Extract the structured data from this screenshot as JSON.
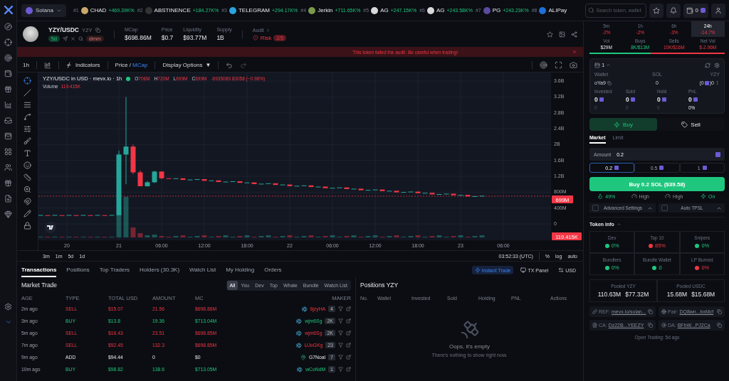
{
  "topbar": {
    "chain": "Solana",
    "trending": [
      {
        "rank": "#1",
        "name": "CHAD",
        "change": "+469.39K%"
      },
      {
        "rank": "#2",
        "name": "ABSTINENCE",
        "change": "+184.27K%"
      },
      {
        "rank": "#3",
        "name": "TELEGRAM",
        "change": "+294.17K%"
      },
      {
        "rank": "#4",
        "name": "Jerkin",
        "change": "+711.65K%"
      },
      {
        "rank": "#5",
        "name": "AG",
        "change": "+247.15K%"
      },
      {
        "rank": "#6",
        "name": "AG",
        "change": "+243.58K%"
      },
      {
        "rank": "#7",
        "name": "PG",
        "change": "+243.23K%"
      },
      {
        "rank": "#8",
        "name": "ALIPay"
      }
    ],
    "search": {
      "placeholder": "Search token, wallet"
    },
    "wallet_count": "0"
  },
  "token": {
    "pair": "YZY/USDC",
    "symbol": "YZY",
    "age": "5d",
    "tag": "dimm",
    "stats": [
      {
        "label": "MCap",
        "value": "$698.86M"
      },
      {
        "label": "Price",
        "value": "$0.7"
      },
      {
        "label": "Liquidity",
        "value": "$93.77M"
      },
      {
        "label": "Supply",
        "value": "1B"
      }
    ],
    "audit": {
      "label": "Audit",
      "risk": "Risk",
      "score": "2/5"
    }
  },
  "banner": "This token failed the audit. Be careful when trading!",
  "chart_toolbar": {
    "interval": "1h",
    "indicators": "Indicators",
    "price_modes": [
      {
        "label": "Price",
        "selected": false
      },
      {
        "label": "MCap",
        "selected": true
      }
    ],
    "separator": "/",
    "display": "Display Options",
    "display_caret": "▼"
  },
  "chart": {
    "title": "YZY/USDC in USD · mevx.io · 1h",
    "ohlc": [
      {
        "key": "O",
        "value": "706M"
      },
      {
        "key": "H",
        "value": "720M"
      },
      {
        "key": "L",
        "value": "699M"
      },
      {
        "key": "C",
        "value": "699M"
      }
    ],
    "change": "-6935089.83058 (−0.98%)",
    "volume_label": "Volume",
    "volume_value": "119.415K",
    "y_labels": [
      "3.6B",
      "3.2B",
      "2.8B",
      "2.4B",
      "2B",
      "1.6B",
      "1.2B",
      "800M",
      "400M",
      "0"
    ],
    "x_labels": [
      "20",
      "21",
      "06:00",
      "12:00",
      "18:00",
      "22",
      "06:00",
      "12:00",
      "18:00",
      "23",
      "06:00"
    ],
    "price_tag": "699M",
    "volume_tag": "119.415K",
    "ranges": [
      "3m",
      "1m",
      "5d",
      "1d"
    ],
    "clock": "03:52:33 (UTC)",
    "scale_options": [
      "%",
      "log",
      "auto"
    ]
  },
  "bottom_tabs": [
    {
      "label": "Transactions",
      "selected": true
    },
    {
      "label": "Positions",
      "selected": false
    },
    {
      "label": "Top Traders",
      "selected": false
    },
    {
      "label": "Holders (30.3K)",
      "selected": false
    },
    {
      "label": "Watch List",
      "selected": false
    },
    {
      "label": "My Holding",
      "selected": false
    },
    {
      "label": "Orders",
      "selected": false
    }
  ],
  "trade_options": [
    {
      "label": "Instant Trade",
      "selected": true
    },
    {
      "label": "TX Panel",
      "selected": false
    },
    {
      "label": "USD",
      "selected": false
    }
  ],
  "market_trade": {
    "title": "Market Trade",
    "filters": [
      {
        "label": "All",
        "selected": true
      },
      {
        "label": "You",
        "selected": false
      },
      {
        "label": "Dev",
        "selected": false
      },
      {
        "label": "Top",
        "selected": false
      },
      {
        "label": "Whale",
        "selected": false
      },
      {
        "label": "Bundle",
        "selected": false
      },
      {
        "label": "Watch List",
        "selected": false
      }
    ],
    "columns": [
      "AGE",
      "TYPE",
      "TOTAL USD",
      "AMOUNT",
      "MC",
      "MAKER"
    ],
    "rows": [
      {
        "age": "2m ago",
        "type": "SELL",
        "kind": "sell",
        "total": "$15.07",
        "amount": "21.56",
        "mc": "$698.86M",
        "maker": "6jzyHA",
        "count": "4"
      },
      {
        "age": "3m ago",
        "type": "BUY",
        "kind": "buy",
        "total": "$13.8",
        "amount": "19.36",
        "mc": "$713.04M",
        "maker": "wjm6Sg",
        "count": "2K"
      },
      {
        "age": "5m ago",
        "type": "SELL",
        "kind": "sell",
        "total": "$16.43",
        "amount": "23.51",
        "mc": "$698.85M",
        "maker": "wjm6Sg",
        "count": "2K"
      },
      {
        "age": "7m ago",
        "type": "SELL",
        "kind": "sell",
        "total": "$92.45",
        "amount": "132.3",
        "mc": "$698.85M",
        "maker": "UJoGKg",
        "count": "23"
      },
      {
        "age": "9m ago",
        "type": "ADD",
        "kind": "add",
        "total": "$94.44",
        "amount": "0",
        "mc": "$0",
        "maker": "G7Noal",
        "count": "7"
      },
      {
        "age": "10m ago",
        "type": "BUY",
        "kind": "buy",
        "total": "$98.82",
        "amount": "138.6",
        "mc": "$713.05M",
        "maker": "wCoNdM",
        "count": "1"
      }
    ]
  },
  "positions": {
    "title": "Positions YZY",
    "columns": [
      "No.",
      "Wallet",
      "Invested",
      "Sold",
      "Holding",
      "PNL",
      "Actions"
    ],
    "empty_title": "Oops, it's empty",
    "empty_text": "There's nothing to show right now."
  },
  "stats_panel": {
    "periods": [
      {
        "label": "5m",
        "change": "-2%",
        "selected": false
      },
      {
        "label": "1h",
        "change": "-2%",
        "selected": false
      },
      {
        "label": "6h",
        "change": "-3%",
        "selected": false
      },
      {
        "label": "24h",
        "change": "-14.7%",
        "selected": true
      }
    ],
    "volumes": [
      {
        "label": "Vol",
        "value": "$29M",
        "kind": "total"
      },
      {
        "label": "Buys",
        "value": "8K/$13M",
        "kind": "buy"
      },
      {
        "label": "Sells",
        "value": "10K/$16M",
        "kind": "sell"
      },
      {
        "label": "Net Vol",
        "value": "$-2.96M",
        "kind": "sell"
      }
    ],
    "buy_share": {
      "level": 0.45
    }
  },
  "wallet": {
    "count": "1",
    "columns": [
      "Wallet",
      "SOL",
      "YZY"
    ],
    "name": "oYa9",
    "sol": "0",
    "yzy_open": "(0",
    "yzy_close": ")0",
    "metrics": [
      {
        "label": "Invested",
        "value": "0",
        "sub": "0"
      },
      {
        "label": "Sold",
        "value": "0",
        "sub": "0"
      },
      {
        "label": "Hold",
        "value": "0",
        "sub": "0"
      },
      {
        "label": "PnL",
        "value": "0",
        "sub": "0%"
      }
    ]
  },
  "trade": {
    "sides": [
      {
        "label": "Buy",
        "selected": true
      },
      {
        "label": "Sell",
        "selected": false
      }
    ],
    "order_types": [
      {
        "label": "Market",
        "selected": true
      },
      {
        "label": "Limit",
        "selected": false
      }
    ],
    "amount_label": "Amount",
    "amount": "0.2",
    "presets": [
      {
        "label": "0.2",
        "selected": true
      },
      {
        "label": "0.5",
        "selected": false
      },
      {
        "label": "1",
        "selected": false
      }
    ],
    "submit": "Buy 0.2 SOL ($39.58)",
    "settings": [
      {
        "value": "49%",
        "kind": "active"
      },
      {
        "value": "High",
        "kind": "plain"
      },
      {
        "value": "High",
        "kind": "plain"
      },
      {
        "value": "On",
        "kind": "active"
      }
    ],
    "options": [
      {
        "label": "Advanced Settings",
        "checked": false
      },
      {
        "label": "Auto TPSL",
        "checked": false
      }
    ]
  },
  "token_info": {
    "title": "Token info",
    "metrics": [
      {
        "label": "Dev",
        "value": "0%",
        "color": "#1fc77e"
      },
      {
        "label": "Top 10",
        "value": "85%",
        "color": "#f23645"
      },
      {
        "label": "Snipers",
        "value": "0%",
        "color": "#1fc77e"
      },
      {
        "label": "Bundlers",
        "value": "0%",
        "color": "#1fc77e"
      },
      {
        "label": "Bundle Wallet",
        "value": "0",
        "color": "#1fc77e"
      },
      {
        "label": "LP Burned",
        "value": "0%",
        "color": "#f23645"
      }
    ],
    "pools": [
      {
        "label": "Pooled YZY",
        "amount": "110.63M",
        "value": "$77.32M"
      },
      {
        "label": "Pooled USDC",
        "amount": "15.68M",
        "value": "$15.68M"
      }
    ],
    "links": [
      {
        "label": "REF:",
        "value": "mevx.io/solan..."
      },
      {
        "label": "Pair:",
        "value": "DQ8wn...bxMcf"
      },
      {
        "label": "CA:",
        "value": "Dz22B...YEEZY"
      },
      {
        "label": "DA:",
        "value": "BFhW...PJ2Ca"
      }
    ],
    "open_trading": "Open Trading: 5d ago"
  }
}
